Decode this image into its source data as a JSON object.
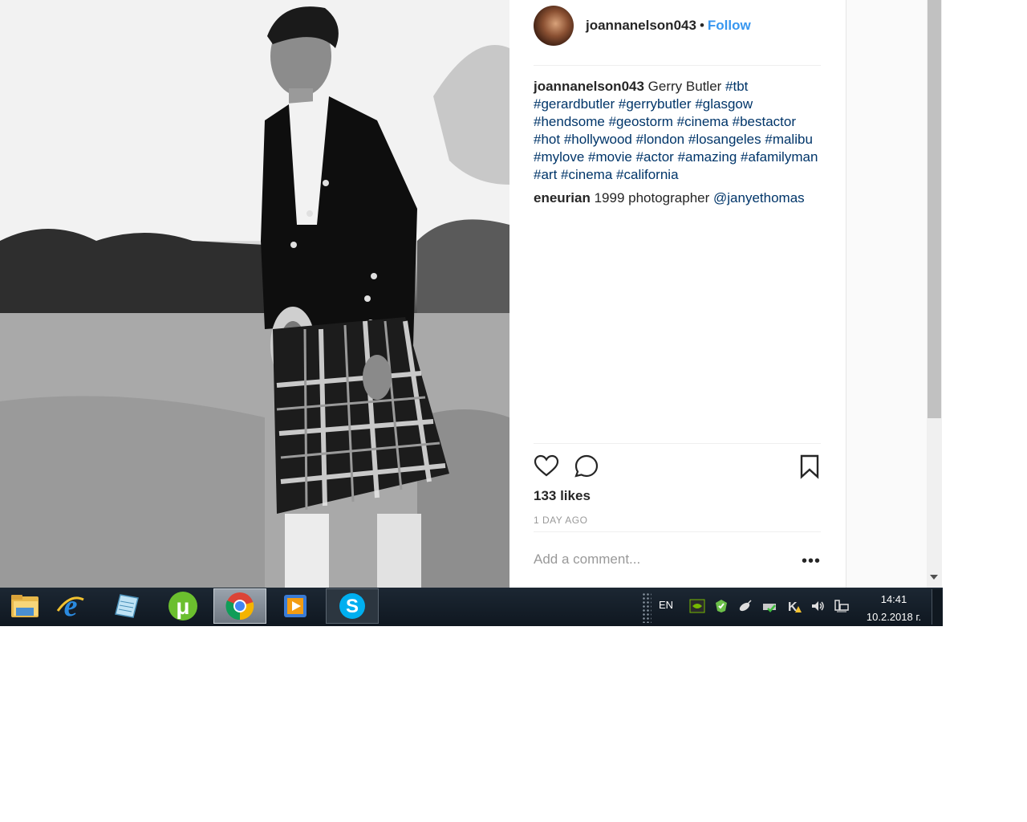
{
  "post": {
    "username": "joannanelson043",
    "separator": "•",
    "follow_label": "Follow",
    "caption": {
      "username": "joannanelson043",
      "text": "Gerry Butler",
      "tags_line1": "#tbt",
      "tags": [
        "#gerardbutler",
        "#gerrybutler",
        "#glasgow",
        "#hendsome",
        "#geostorm",
        "#cinema",
        "#bestactor",
        "#hot",
        "#hollywood",
        "#london",
        "#losangeles",
        "#malibu",
        "#mylove",
        "#movie",
        "#actor",
        "#amazing",
        "#afamilyman",
        "#art",
        "#cinema",
        "#california"
      ]
    },
    "comment": {
      "username": "eneurian",
      "text": "1999 photographer",
      "mention": "@janyethomas"
    },
    "likes": "133 likes",
    "time": "1 DAY AGO",
    "add_comment_placeholder": "Add a comment...",
    "more_label": "•••",
    "accent_color": "#3897f0",
    "hashtag_color": "#003569"
  },
  "taskbar": {
    "apps": [
      "file-explorer",
      "internet-explorer",
      "notepad",
      "utorrent",
      "chrome",
      "media-player",
      "skype"
    ],
    "language": "EN",
    "time": "14:41",
    "date": "10.2.2018 г."
  }
}
